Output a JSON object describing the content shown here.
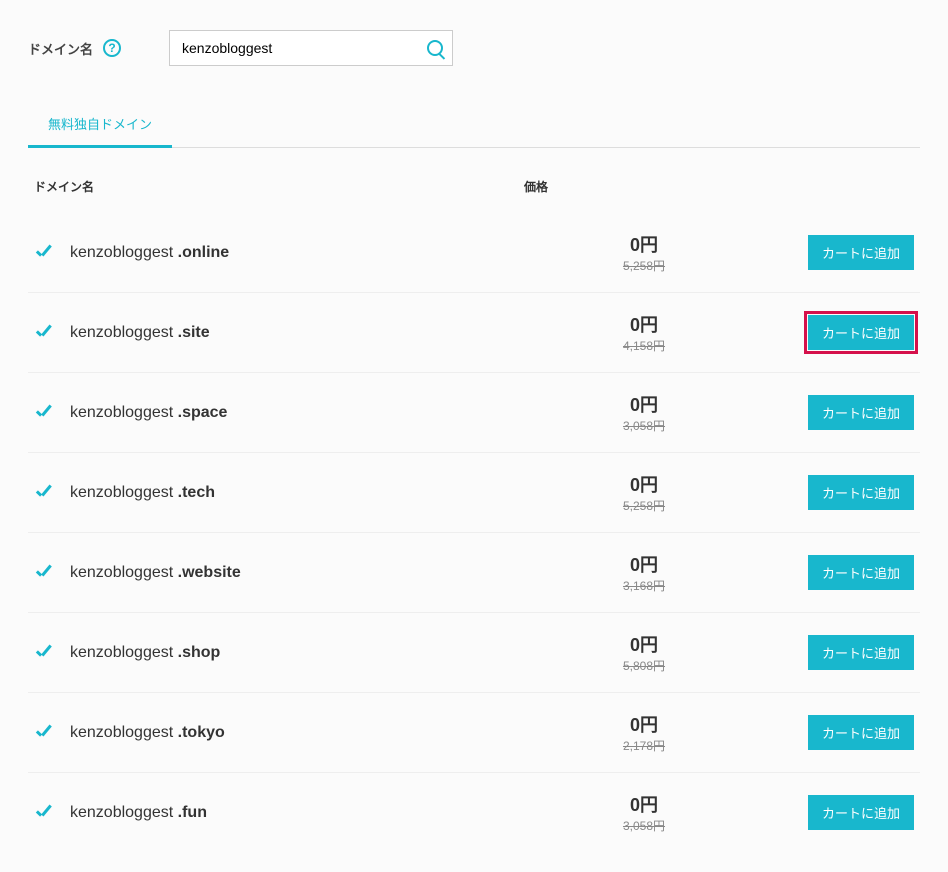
{
  "search": {
    "label": "ドメイン名",
    "help": "?",
    "value": "kenzobloggest"
  },
  "tabs": {
    "active": "無料独自ドメイン"
  },
  "headers": {
    "domain": "ドメイン名",
    "price": "価格"
  },
  "add_label": "カートに追加",
  "results": [
    {
      "base": "kenzobloggest ",
      "ext": ".online",
      "price": "0円",
      "old": "5,258円",
      "highlight": false
    },
    {
      "base": "kenzobloggest ",
      "ext": ".site",
      "price": "0円",
      "old": "4,158円",
      "highlight": true
    },
    {
      "base": "kenzobloggest ",
      "ext": ".space",
      "price": "0円",
      "old": "3,058円",
      "highlight": false
    },
    {
      "base": "kenzobloggest ",
      "ext": ".tech",
      "price": "0円",
      "old": "5,258円",
      "highlight": false
    },
    {
      "base": "kenzobloggest ",
      "ext": ".website",
      "price": "0円",
      "old": "3,168円",
      "highlight": false
    },
    {
      "base": "kenzobloggest ",
      "ext": ".shop",
      "price": "0円",
      "old": "5,808円",
      "highlight": false
    },
    {
      "base": "kenzobloggest ",
      "ext": ".tokyo",
      "price": "0円",
      "old": "2,178円",
      "highlight": false
    },
    {
      "base": "kenzobloggest ",
      "ext": ".fun",
      "price": "0円",
      "old": "3,058円",
      "highlight": false
    }
  ]
}
